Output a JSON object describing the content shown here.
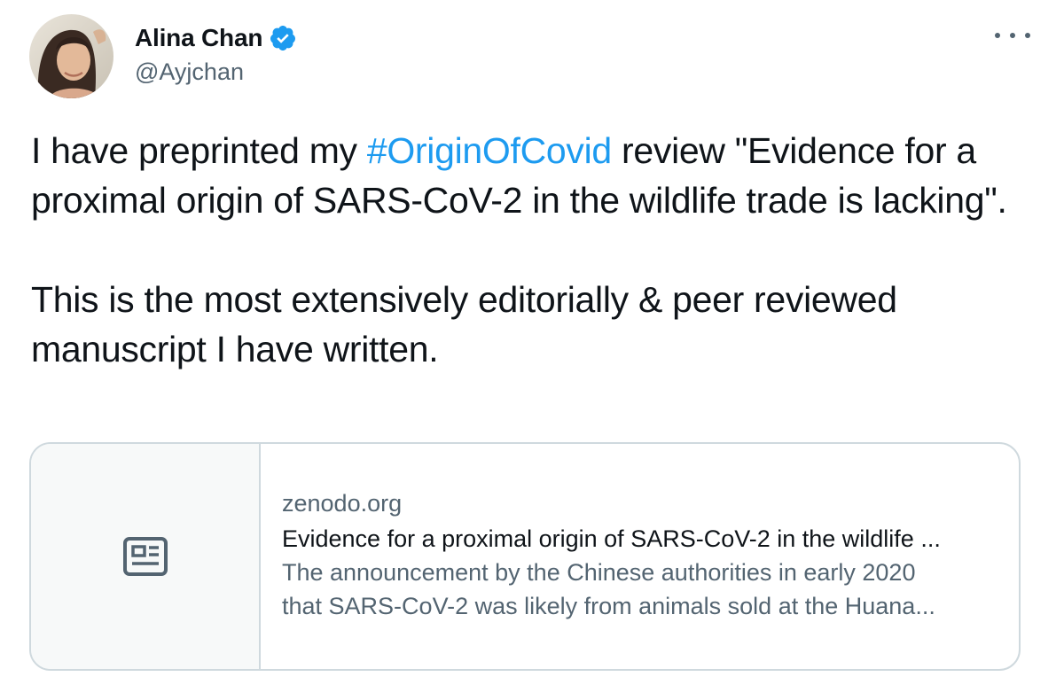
{
  "author": {
    "display_name": "Alina Chan",
    "handle": "@Ayjchan",
    "verified": true
  },
  "tweet": {
    "text_part1": "I have preprinted my ",
    "hashtag": "#OriginOfCovid",
    "text_part2": " review \"Evidence for a proximal origin of SARS-CoV-2 in the wildlife trade is lacking\".",
    "text_para2": "This is the most extensively editorially & peer reviewed manuscript I have written."
  },
  "link_card": {
    "domain": "zenodo.org",
    "title": "Evidence for a proximal origin of SARS-CoV-2 in the wildlife ...",
    "description_line1": "The announcement by the Chinese authorities in early 2020",
    "description_line2": "that SARS-CoV-2 was likely from animals sold at the Huana...",
    "thumbnail_icon": "news-article-icon"
  },
  "icons": {
    "verified": "verified-badge-icon",
    "more": "more-options-icon"
  },
  "colors": {
    "hashtag": "#1d9bf0",
    "verified_badge": "#1d9bf0",
    "secondary_text": "#536471",
    "border": "#cfd9de"
  }
}
